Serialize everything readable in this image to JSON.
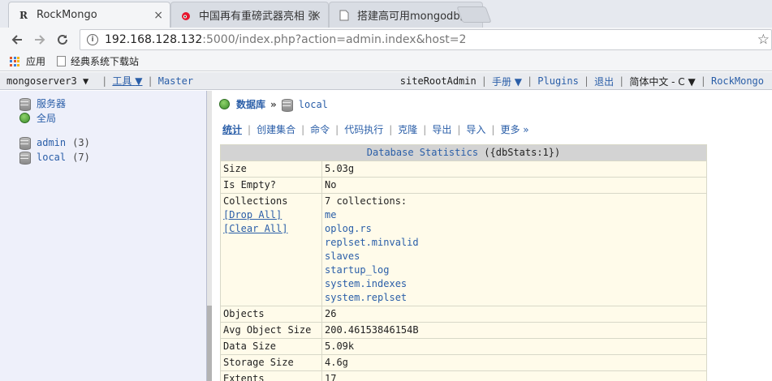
{
  "browser": {
    "tabs": [
      {
        "label": "RockMongo",
        "favicon": "R",
        "close": "×"
      },
      {
        "label": "中国再有重磅武器亮相 张",
        "favicon": "weibo-icon",
        "close": "×"
      },
      {
        "label": "搭建高可用mongodb副",
        "favicon": "doc-icon",
        "close": "×"
      }
    ],
    "address": {
      "host": "192.168.128.132",
      "rest": ":5000/index.php?action=admin.index&host=2"
    },
    "bookmarks": [
      "应用",
      "经典系统下载站"
    ]
  },
  "rm_header": {
    "server": "mongoserver3",
    "tools": "工具",
    "master": "Master",
    "user": "siteRootAdmin",
    "manual": "手册",
    "plugins": "Plugins",
    "logout": "退出",
    "language": "简体中文 - C",
    "brand": "RockMongo",
    "sep": "|",
    "caret": "▼"
  },
  "sidebar": {
    "server": "服务器",
    "global": "全局",
    "databases": [
      {
        "name": "admin",
        "count": "(3)"
      },
      {
        "name": "local",
        "count": "(7)"
      }
    ]
  },
  "main": {
    "crumb_db": "数据库",
    "crumb_arrow": "»",
    "crumb_name": "local",
    "tabs": [
      "统计",
      "创建集合",
      "命令",
      "代码执行",
      "克隆",
      "导出",
      "导入",
      "更多 »"
    ],
    "tab_sep": "|",
    "stats": {
      "title": "Database Statistics",
      "title_cmd": "({dbStats:1})",
      "rows": {
        "size": {
          "k": "Size",
          "v": "5.03g"
        },
        "empty": {
          "k": "Is Empty?",
          "v": "No"
        },
        "collections": {
          "k": "Collections",
          "v": "7 collections:",
          "drop": "[Drop All]",
          "clear": "[Clear All]",
          "list": [
            "me",
            "oplog.rs",
            "replset.minvalid",
            "slaves",
            "startup_log",
            "system.indexes",
            "system.replset"
          ]
        },
        "objects": {
          "k": "Objects",
          "v": "26"
        },
        "avg": {
          "k": "Avg Object Size",
          "v": "200.46153846154B"
        },
        "data": {
          "k": "Data Size",
          "v": "5.09k"
        },
        "storage": {
          "k": "Storage Size",
          "v": "4.6g"
        },
        "extents": {
          "k": "Extents",
          "v": "17"
        }
      }
    }
  }
}
